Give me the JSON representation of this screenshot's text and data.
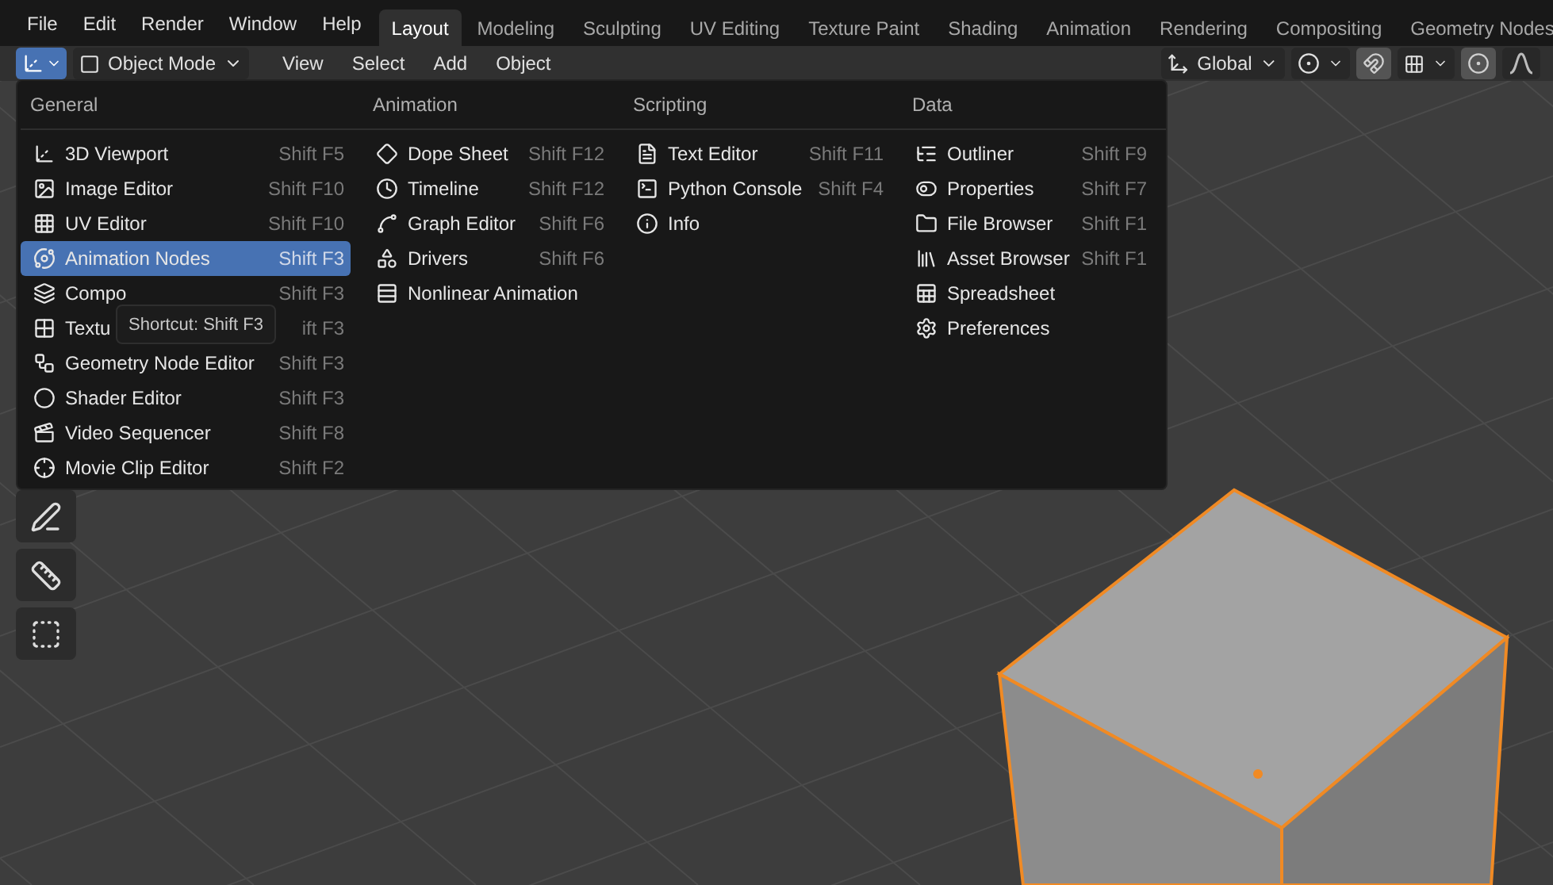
{
  "topbar": {
    "menus": [
      "File",
      "Edit",
      "Render",
      "Window",
      "Help"
    ],
    "workspaces": [
      {
        "label": "Layout",
        "selected": true
      },
      {
        "label": "Modeling",
        "selected": false
      },
      {
        "label": "Sculpting",
        "selected": false
      },
      {
        "label": "UV Editing",
        "selected": false
      },
      {
        "label": "Texture Paint",
        "selected": false
      },
      {
        "label": "Shading",
        "selected": false
      },
      {
        "label": "Animation",
        "selected": false
      },
      {
        "label": "Rendering",
        "selected": false
      },
      {
        "label": "Compositing",
        "selected": false
      },
      {
        "label": "Geometry Nodes",
        "selected": false
      }
    ]
  },
  "header": {
    "editor_button": {
      "selected": true
    },
    "mode": "Object Mode",
    "menus": [
      "View",
      "Select",
      "Add",
      "Object"
    ],
    "orientation": "Global",
    "snap": {
      "on": true
    },
    "proportional": {
      "on": true
    }
  },
  "editor_menu": {
    "columns": [
      {
        "title": "General",
        "items": [
          {
            "label": "3D Viewport",
            "shortcut": "Shift F5",
            "selected": false
          },
          {
            "label": "Image Editor",
            "shortcut": "Shift F10",
            "selected": false
          },
          {
            "label": "UV Editor",
            "shortcut": "Shift F10",
            "selected": false
          },
          {
            "label": "Animation Nodes",
            "shortcut": "Shift F3",
            "selected": true
          },
          {
            "label": "Compo",
            "shortcut": "Shift F3",
            "selected": false
          },
          {
            "label": "Textu",
            "shortcut": "ift F3",
            "selected": false
          },
          {
            "label": "Geometry Node Editor",
            "shortcut": "Shift F3",
            "selected": false
          },
          {
            "label": "Shader Editor",
            "shortcut": "Shift F3",
            "selected": false
          },
          {
            "label": "Video Sequencer",
            "shortcut": "Shift F8",
            "selected": false
          },
          {
            "label": "Movie Clip Editor",
            "shortcut": "Shift F2",
            "selected": false
          }
        ]
      },
      {
        "title": "Animation",
        "items": [
          {
            "label": "Dope Sheet",
            "shortcut": "Shift F12",
            "selected": false
          },
          {
            "label": "Timeline",
            "shortcut": "Shift F12",
            "selected": false
          },
          {
            "label": "Graph Editor",
            "shortcut": "Shift F6",
            "selected": false
          },
          {
            "label": "Drivers",
            "shortcut": "Shift F6",
            "selected": false
          },
          {
            "label": "Nonlinear Animation",
            "selected": false
          }
        ]
      },
      {
        "title": "Scripting",
        "items": [
          {
            "label": "Text Editor",
            "shortcut": "Shift F11",
            "selected": false
          },
          {
            "label": "Python Console",
            "shortcut": "Shift F4",
            "selected": false
          },
          {
            "label": "Info",
            "selected": false
          }
        ]
      },
      {
        "title": "Data",
        "items": [
          {
            "label": "Outliner",
            "shortcut": "Shift F9",
            "selected": false
          },
          {
            "label": "Properties",
            "shortcut": "Shift F7",
            "selected": false
          },
          {
            "label": "File Browser",
            "shortcut": "Shift F1",
            "selected": false
          },
          {
            "label": "Asset Browser",
            "shortcut": "Shift F1",
            "selected": false
          },
          {
            "label": "Spreadsheet",
            "selected": false
          },
          {
            "label": "Preferences",
            "selected": false
          }
        ]
      }
    ]
  },
  "tooltip": {
    "text": "Shortcut: Shift F3"
  }
}
